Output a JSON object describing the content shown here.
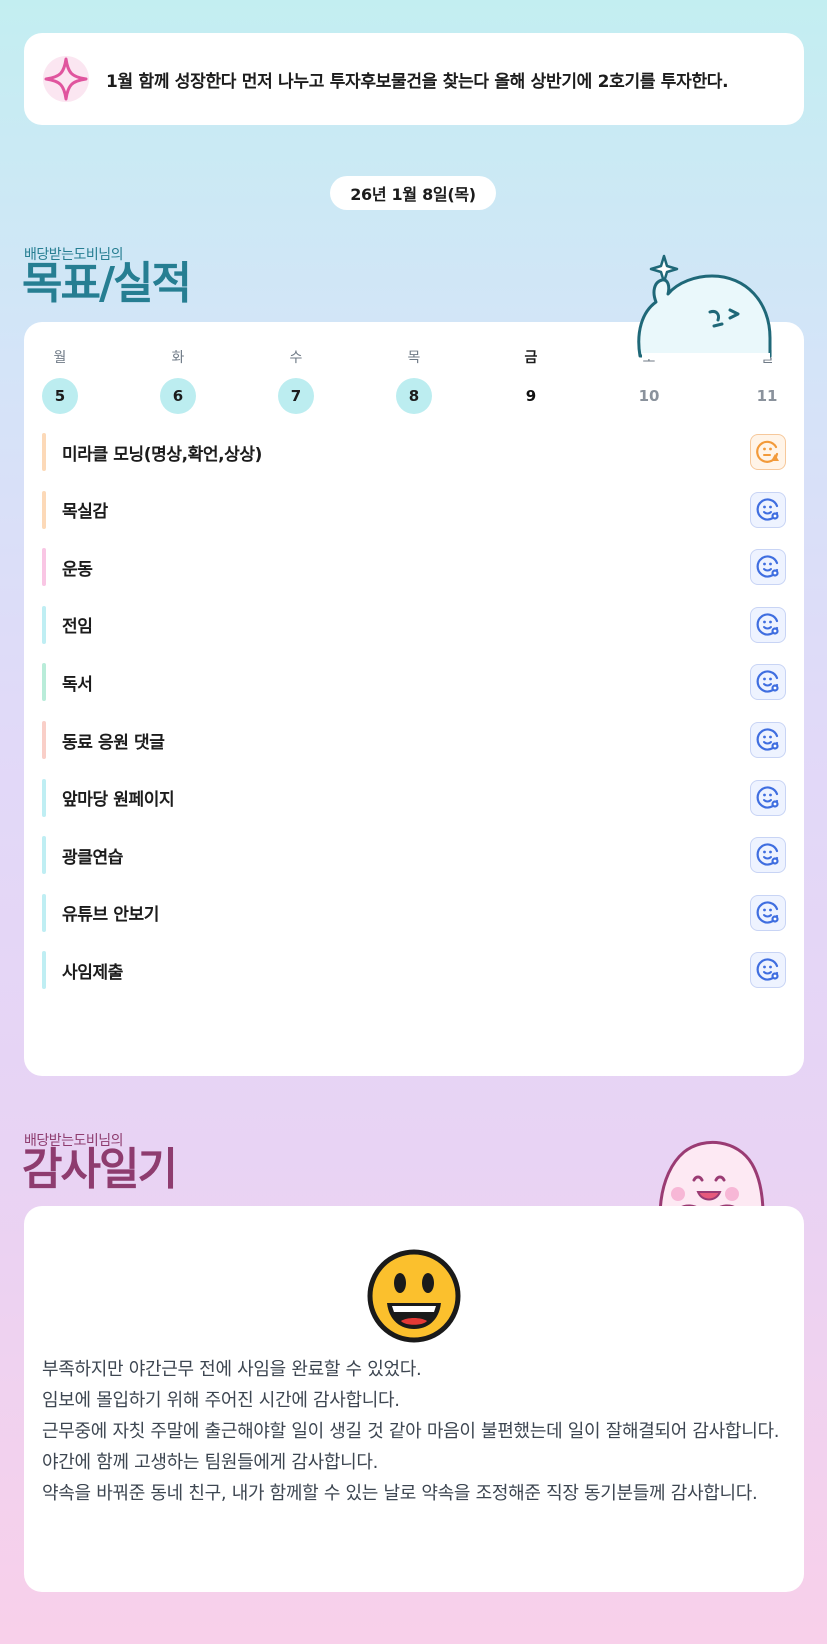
{
  "banner": {
    "icon": "sparkle-star-icon",
    "text": "1월 함께 성장한다 먼저 나누고 투자후보물건을 찾는다 올해 상반기에 2호기를 투자한다."
  },
  "date": "26년 1월 8일(목)",
  "goals_section": {
    "owner_label": "배당받는도비님의",
    "title": "목표/실적"
  },
  "week": [
    {
      "dow": "월",
      "num": "5",
      "state": "done"
    },
    {
      "dow": "화",
      "num": "6",
      "state": "done"
    },
    {
      "dow": "수",
      "num": "7",
      "state": "done"
    },
    {
      "dow": "목",
      "num": "8",
      "state": "done"
    },
    {
      "dow": "금",
      "num": "9",
      "state": "today"
    },
    {
      "dow": "토",
      "num": "10",
      "state": "future"
    },
    {
      "dow": "일",
      "num": "11",
      "state": "future"
    }
  ],
  "tasks": [
    {
      "label": "미라클 모닝(명상,확언,상상)",
      "bar_color": "#fcd9b8",
      "status": "warn",
      "icon": "face-warning-icon"
    },
    {
      "label": "목실감",
      "bar_color": "#fcd9b8",
      "status": "ok",
      "icon": "face-check-icon"
    },
    {
      "label": "운동",
      "bar_color": "#f9c6e4",
      "status": "ok",
      "icon": "face-check-icon"
    },
    {
      "label": "전임",
      "bar_color": "#bfeef3",
      "status": "ok",
      "icon": "face-check-icon"
    },
    {
      "label": "독서",
      "bar_color": "#b9ecd9",
      "status": "ok",
      "icon": "face-check-icon"
    },
    {
      "label": "동료 응원 댓글",
      "bar_color": "#f9cfc8",
      "status": "ok",
      "icon": "face-check-icon"
    },
    {
      "label": "앞마당 원페이지",
      "bar_color": "#bfeef3",
      "status": "ok",
      "icon": "face-check-icon"
    },
    {
      "label": "광클연습",
      "bar_color": "#bfeef3",
      "status": "ok",
      "icon": "face-check-icon"
    },
    {
      "label": "유튜브 안보기",
      "bar_color": "#bfeef3",
      "status": "ok",
      "icon": "face-check-icon"
    },
    {
      "label": "사임제출",
      "bar_color": "#bfeef3",
      "status": "ok",
      "icon": "face-check-icon"
    }
  ],
  "gratitude_section": {
    "owner_label": "배당받는도비님의",
    "title": "감사일기",
    "emoji": "grinning-face-icon",
    "lines": [
      "부족하지만 야간근무 전에 사임을 완료할 수 있었다.",
      "임보에 몰입하기 위해 주어진 시간에 감사합니다.",
      "근무중에 자칫 주말에 출근해야할 일이 생길 것 같아 마음이 불편했는데 일이 잘해결되어 감사합니다.",
      "야간에 함께 고생하는 팀원들에게 감사합니다.",
      "약속을 바꿔준 동네 친구, 내가 함께할 수 있는 날로 약속을 조정해준 직장 동기분들께 감사합니다."
    ]
  },
  "colors": {
    "teal_title": "#267e92",
    "purple_title": "#8e3c6f",
    "done_circle": "#bcedf0",
    "status_ok": "#3f6ee0",
    "status_warn": "#f29a3a"
  }
}
